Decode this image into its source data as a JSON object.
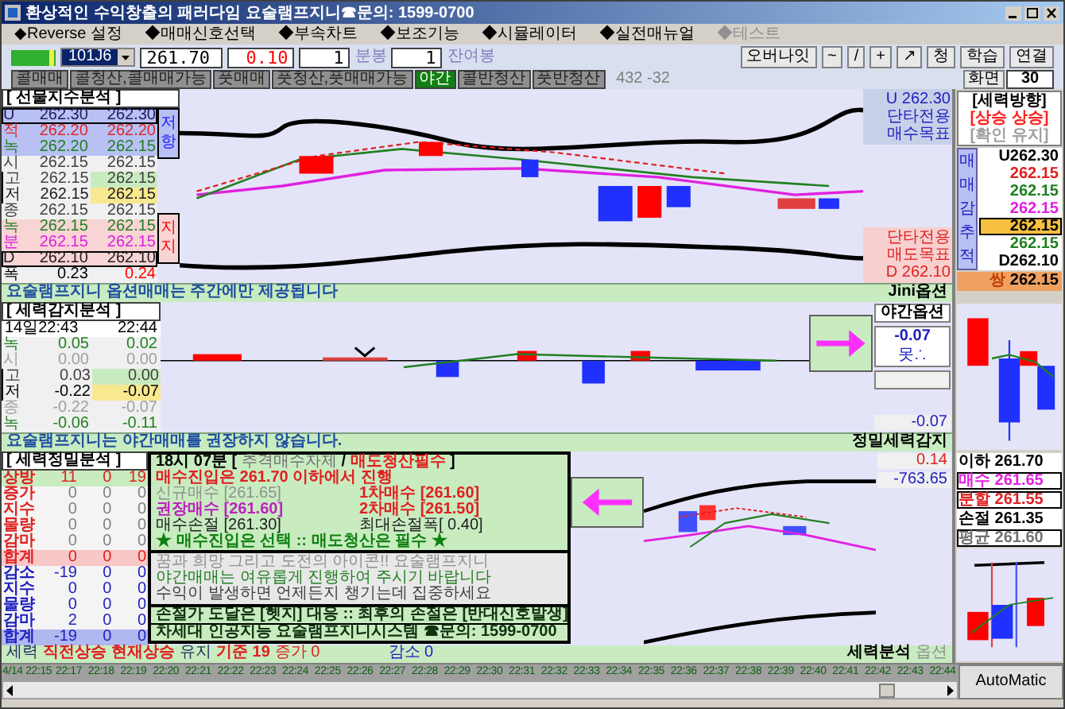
{
  "window": {
    "title": "환상적인 수익창출의 패러다임 요술램프지니☎문의: 1599-0700"
  },
  "menu": [
    {
      "label": "◆Reverse 설정",
      "disabled": false
    },
    {
      "label": "◆매매신호선택",
      "disabled": false
    },
    {
      "label": "◆부속차트",
      "disabled": false
    },
    {
      "label": "◆보조기능",
      "disabled": false
    },
    {
      "label": "◆시뮬레이터",
      "disabled": false
    },
    {
      "label": "◆실전매뉴얼",
      "disabled": false
    },
    {
      "label": "◆테스트",
      "disabled": true
    }
  ],
  "toolbar": {
    "symbol": "101J6",
    "price": "261.70",
    "change": "0.10",
    "bar_count": "1",
    "bar_unit": "분봉",
    "remain_count": "1",
    "remain_unit": "잔여봉",
    "buttons": [
      "오버나잇",
      "~",
      "/",
      "+",
      "↗",
      "청",
      "학습",
      "연결"
    ]
  },
  "modes": [
    {
      "label": "콜매매",
      "on": false
    },
    {
      "label": "콜청산,콜매매가능",
      "on": false
    },
    {
      "label": "풋매매",
      "on": false
    },
    {
      "label": "풋청산,풋매매가능",
      "on": false
    },
    {
      "label": "야간",
      "on": true
    },
    {
      "label": "콜반청산",
      "on": false
    },
    {
      "label": "풋반청산",
      "on": false
    }
  ],
  "counter": "432 -32",
  "screen": {
    "label": "화면",
    "value": "30"
  },
  "futures": {
    "title": "[ 선물지수분석 ]",
    "resist_label": "저항",
    "support_label": "지지",
    "rows": [
      {
        "label": "U",
        "values": [
          "262.30",
          "262.30"
        ],
        "color": "#202060",
        "kind": "resist-edge"
      },
      {
        "label": "적",
        "values": [
          "262.20",
          "262.20"
        ],
        "color": "#e02828",
        "kind": "resist"
      },
      {
        "label": "녹",
        "values": [
          "262.20",
          "262.15"
        ],
        "color": "#208020",
        "kind": "resist"
      },
      {
        "label": "시",
        "values": [
          "262.15",
          "262.15"
        ],
        "color": "#404040",
        "kind": "plain"
      },
      {
        "label": "고",
        "values": [
          "262.15",
          "262.15"
        ],
        "color": "#404040",
        "kind": "high"
      },
      {
        "label": "저",
        "values": [
          "262.15",
          "262.15"
        ],
        "color": "#202020",
        "kind": "low"
      },
      {
        "label": "종",
        "values": [
          "262.15",
          "262.15"
        ],
        "color": "#404040",
        "kind": "plain"
      },
      {
        "label": "녹",
        "values": [
          "262.15",
          "262.15"
        ],
        "color": "#208020",
        "kind": "support"
      },
      {
        "label": "분",
        "values": [
          "262.15",
          "262.15"
        ],
        "color": "#e020e0",
        "kind": "support"
      },
      {
        "label": "D",
        "values": [
          "262.10",
          "262.10"
        ],
        "color": "#202020",
        "kind": "support-edge"
      },
      {
        "label": "폭",
        "values": [
          "0.23",
          "0.24"
        ],
        "color": "#000000",
        "kind": "width"
      }
    ],
    "upper_note": [
      "U 262.30",
      "단타전용",
      "매수목표"
    ],
    "lower_note": [
      "단타전용",
      "매도목표",
      "D 262.10"
    ],
    "banner": "요술램프지니 옵션매매는 주간에만 제공됩니다",
    "banner_tag": "Jini옵션"
  },
  "direction": {
    "title": "[세력방향]",
    "state": "[상승 상승]",
    "confirm": "[확인 유지]",
    "side_label": "매매감추적",
    "rows": [
      {
        "value": "U262.30",
        "color": "#000000",
        "kind": "plain"
      },
      {
        "value": "262.15",
        "color": "#e02020",
        "kind": "plain"
      },
      {
        "value": "262.15",
        "color": "#208020",
        "kind": "plain"
      },
      {
        "value": "262.15",
        "color": "#e020e0",
        "kind": "plain"
      },
      {
        "value": "262.15",
        "color": "#000000",
        "kind": "mark"
      },
      {
        "value": "262.15",
        "color": "#208020",
        "kind": "plain"
      },
      {
        "value": "D262.10",
        "color": "#000000",
        "kind": "plain"
      }
    ],
    "summary_icon": "쌍",
    "summary": "262.15"
  },
  "detect": {
    "title": "[ 세력감지분석 ]",
    "date": "14일22:43",
    "time": "22:44",
    "rows": [
      {
        "label": "녹",
        "values": [
          "0.05",
          "0.02"
        ],
        "color": "#208020",
        "kind": "plain"
      },
      {
        "label": "시",
        "values": [
          "0.00",
          "0.00"
        ],
        "color": "#a0a0a0",
        "kind": "plain"
      },
      {
        "label": "고",
        "values": [
          "0.03",
          "0.00"
        ],
        "color": "#404040",
        "kind": "high"
      },
      {
        "label": "저",
        "values": [
          "-0.22",
          "-0.07"
        ],
        "color": "#000000",
        "kind": "low"
      },
      {
        "label": "종",
        "values": [
          "-0.22",
          "-0.07"
        ],
        "color": "#a0a0a0",
        "kind": "plain"
      },
      {
        "label": "녹",
        "values": [
          "-0.06",
          "-0.11"
        ],
        "color": "#208020",
        "kind": "plain"
      }
    ],
    "night_label": "야간옵션",
    "night_value": "-0.07",
    "night_status": "못∴",
    "bottom_value": "-0.07",
    "banner": "요술램프지니는 야간매매를 권장하지 않습니다.",
    "banner_tag": "정밀세력감지"
  },
  "precision": {
    "title": "[ 세력정밀분석 ]",
    "rows": [
      {
        "label": "상방",
        "values": [
          "11",
          "0",
          "19"
        ],
        "kind": "head"
      },
      {
        "label": "증가",
        "values": [
          "0",
          "0",
          "0"
        ],
        "kind": "up"
      },
      {
        "label": "지수",
        "values": [
          "0",
          "0",
          "0"
        ],
        "kind": "up"
      },
      {
        "label": "물량",
        "values": [
          "0",
          "0",
          "0"
        ],
        "kind": "up"
      },
      {
        "label": "감마",
        "values": [
          "0",
          "0",
          "0"
        ],
        "kind": "up"
      },
      {
        "label": "합계",
        "values": [
          "0",
          "0",
          "0"
        ],
        "kind": "sum-up"
      },
      {
        "label": "감소",
        "values": [
          "-19",
          "0",
          "0"
        ],
        "kind": "down"
      },
      {
        "label": "지수",
        "values": [
          "0",
          "0",
          "0"
        ],
        "kind": "down"
      },
      {
        "label": "물량",
        "values": [
          "0",
          "0",
          "0"
        ],
        "kind": "down"
      },
      {
        "label": "감마",
        "values": [
          "2",
          "0",
          "0"
        ],
        "kind": "down"
      },
      {
        "label": "합계",
        "values": [
          "-19",
          "0",
          "0"
        ],
        "kind": "sum-down"
      }
    ],
    "info": {
      "heading": [
        {
          "text": "18시 07분 [",
          "kind": "plain"
        },
        {
          "text": "추격매수자제",
          "kind": "dim"
        },
        {
          "text": "/",
          "kind": "plain"
        },
        {
          "text": "매도청산필수",
          "kind": "alert"
        },
        {
          "text": "]",
          "kind": "plain"
        }
      ],
      "entry": "매수진입은 261.70 이하에서 진행",
      "orders": [
        {
          "text": "신규매수 [261.65]",
          "kind": "dim"
        },
        {
          "text": "1차매수 [261.60]",
          "kind": "alert"
        },
        {
          "text": "권장매수 [261.60]",
          "kind": "pick"
        },
        {
          "text": "2차매수 [261.50]",
          "kind": "alert"
        },
        {
          "text": "매수손절 [261.30]",
          "kind": "plain"
        },
        {
          "text": "최대손절폭[ 0.40]",
          "kind": "plain"
        }
      ],
      "motto": "★ 매수진입은 선택 :: 매도청산은 필수 ★",
      "messages": [
        {
          "text": "꿈과 희망 그리고 도전의 아이콘!! 요술램프지니",
          "kind": "dim"
        },
        {
          "text": "야간매매는 여유롭게 진행하여 주시기 바랍니다",
          "kind": "green"
        },
        {
          "text": "수익이 발생하면 언제든지 챙기는데 집중하세요",
          "kind": "plain"
        }
      ],
      "notes": [
        "손절가 도달은 [헷지] 대응 :: 최후의 손절은 [반대신호발생]",
        "차세대 인공지능 요술램프지니시스템 ☎문의: 1599-0700"
      ]
    },
    "value_a": "0.14",
    "value_b": "-763.65"
  },
  "levels": [
    {
      "label": "이하",
      "value": "261.70",
      "kind": "plain"
    },
    {
      "label": "매수",
      "value": "261.65",
      "kind": "buy"
    },
    {
      "label": "분할",
      "value": "261.55",
      "kind": "split"
    },
    {
      "label": "손절",
      "value": "261.35",
      "kind": "plain"
    },
    {
      "label": "평균",
      "value": "261.60",
      "kind": "avg"
    }
  ],
  "status": [
    {
      "text": "세력",
      "kind": "label"
    },
    {
      "text": "직전상승",
      "kind": "up"
    },
    {
      "text": "현재상승",
      "kind": "up"
    },
    {
      "text": "유지",
      "kind": "plain"
    },
    {
      "text": "기준 19",
      "kind": "up"
    },
    {
      "text": "증가 0",
      "kind": "rise"
    },
    {
      "text": "감소 0",
      "kind": "down"
    },
    {
      "text": "세력분석",
      "kind": "strong"
    },
    {
      "text": "옵션",
      "kind": "dim"
    }
  ],
  "time_axis": [
    "4/14 22:15",
    "22:17",
    "22:18",
    "22:19",
    "22:20",
    "22:21",
    "22:22",
    "22:23",
    "22:24",
    "22:25",
    "22:26",
    "22:27",
    "22:28",
    "22:29",
    "22:30",
    "22:31",
    "22:32",
    "22:33",
    "22:34",
    "22:35",
    "22:36",
    "22:37",
    "22:38",
    "22:39",
    "22:40",
    "22:41",
    "22:42",
    "22:43",
    "22:44"
  ],
  "automatic": "AutoMatic"
}
